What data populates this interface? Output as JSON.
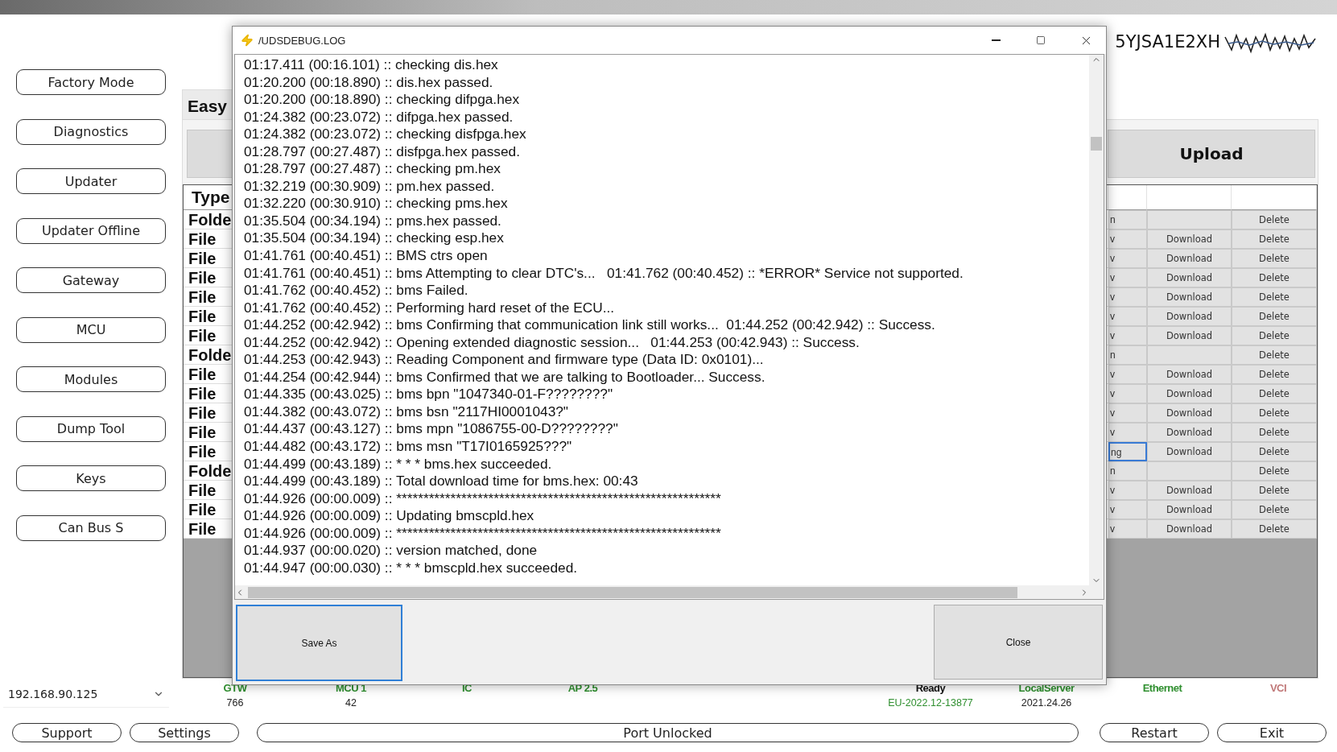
{
  "vin": "5YJSA1E2XH",
  "sidebar": {
    "buttons": [
      "Factory Mode",
      "Diagnostics",
      "Updater",
      "Updater Offline",
      "Gateway",
      "MCU",
      "Modules",
      "Dump Tool",
      "Keys",
      "Can Bus S"
    ]
  },
  "tab": {
    "label": "Easy"
  },
  "upload_button": "Upload",
  "table": {
    "columns": [
      "Type"
    ],
    "rows": [
      {
        "type": "Folde",
        "column_2": "n",
        "delete": "Delete",
        "selected": false
      },
      {
        "type": "File",
        "column_2": "v",
        "download": "Download",
        "delete": "Delete",
        "selected": false
      },
      {
        "type": "File",
        "column_2": "v",
        "download": "Download",
        "delete": "Delete",
        "selected": false
      },
      {
        "type": "File",
        "column_2": "v",
        "download": "Download",
        "delete": "Delete",
        "selected": false
      },
      {
        "type": "File",
        "column_2": "v",
        "download": "Download",
        "delete": "Delete",
        "selected": false
      },
      {
        "type": "File",
        "column_2": "v",
        "download": "Download",
        "delete": "Delete",
        "selected": false
      },
      {
        "type": "File",
        "column_2": "v",
        "download": "Download",
        "delete": "Delete",
        "selected": false
      },
      {
        "type": "Folde",
        "column_2": "n",
        "delete": "Delete",
        "selected": false
      },
      {
        "type": "File",
        "column_2": "v",
        "download": "Download",
        "delete": "Delete",
        "selected": false
      },
      {
        "type": "File",
        "column_2": "v",
        "download": "Download",
        "delete": "Delete",
        "selected": false
      },
      {
        "type": "File",
        "column_2": "v",
        "download": "Download",
        "delete": "Delete",
        "selected": false
      },
      {
        "type": "File",
        "column_2": "v",
        "download": "Download",
        "delete": "Delete",
        "selected": false
      },
      {
        "type": "File",
        "column_2": "ng",
        "download": "Download",
        "delete": "Delete",
        "selected": true
      },
      {
        "type": "Folde",
        "column_2": "n",
        "delete": "Delete",
        "selected": false
      },
      {
        "type": "File",
        "column_2": "v",
        "download": "Download",
        "delete": "Delete",
        "selected": false
      },
      {
        "type": "File",
        "column_2": "v",
        "download": "Download",
        "delete": "Delete",
        "selected": false
      },
      {
        "type": "File",
        "column_2": "v",
        "download": "Download",
        "delete": "Delete",
        "selected": false
      }
    ]
  },
  "dialog": {
    "title": "/UDSDEBUG.LOG",
    "log_lines": [
      "01:17.411 (00:16.101) :: checking dis.hex",
      "01:20.200 (00:18.890) :: dis.hex passed.",
      "01:20.200 (00:18.890) :: checking difpga.hex",
      "01:24.382 (00:23.072) :: difpga.hex passed.",
      "01:24.382 (00:23.072) :: checking disfpga.hex",
      "01:28.797 (00:27.487) :: disfpga.hex passed.",
      "01:28.797 (00:27.487) :: checking pm.hex",
      "01:32.219 (00:30.909) :: pm.hex passed.",
      "01:32.220 (00:30.910) :: checking pms.hex",
      "01:35.504 (00:34.194) :: pms.hex passed.",
      "01:35.504 (00:34.194) :: checking esp.hex",
      "01:41.761 (00:40.451) :: BMS ctrs open",
      "01:41.761 (00:40.451) :: bms Attempting to clear DTC's...   01:41.762 (00:40.452) :: *ERROR* Service not supported.",
      "01:41.762 (00:40.452) :: bms Failed.",
      "01:41.762 (00:40.452) :: Performing hard reset of the ECU...",
      "01:44.252 (00:42.942) :: bms Confirming that communication link still works...  01:44.252 (00:42.942) :: Success.",
      "01:44.252 (00:42.942) :: Opening extended diagnostic session...   01:44.253 (00:42.943) :: Success.",
      "01:44.253 (00:42.943) :: Reading Component and firmware type (Data ID: 0x0101)...",
      "01:44.254 (00:42.944) :: bms Confirmed that we are talking to Bootloader... Success.",
      "01:44.335 (00:43.025) :: bms bpn \"1047340-01-F????????\"",
      "01:44.382 (00:43.072) :: bms bsn \"2117HI0001043?\"",
      "01:44.437 (00:43.127) :: bms mpn \"1086755-00-D????????\"",
      "01:44.482 (00:43.172) :: bms msn \"T17I0165925???\"",
      "01:44.499 (00:43.189) :: * * * bms.hex succeeded.",
      "01:44.499 (00:43.189) :: Total download time for bms.hex: 00:43",
      "01:44.926 (00:00.009) :: ************************************************************",
      "01:44.926 (00:00.009) :: Updating bmscpld.hex",
      "01:44.926 (00:00.009) :: ************************************************************",
      "01:44.937 (00:00.020) :: version matched, done",
      "01:44.947 (00:00.030) :: * * * bmscpld.hex succeeded."
    ],
    "buttons": [
      {
        "label": "Save As",
        "focused": true
      },
      {
        "label": "Close",
        "focused": false
      }
    ]
  },
  "ip_field": {
    "value": "192.168.90.125"
  },
  "status_left": [
    {
      "label": "GTW",
      "color": "#2f8f2f",
      "value": "766",
      "value_highlighted": false
    },
    {
      "label": "MCU 1",
      "color": "#2f8f2f",
      "value": "42",
      "value_highlighted": false
    },
    {
      "label": "IC",
      "color": "#2f8f2f"
    },
    {
      "label": "AP 2.5",
      "color": "#2f8f2f"
    }
  ],
  "status_right": [
    {
      "label": "Ready",
      "color": "#111111",
      "value": "EU-2022.12-13877",
      "value_highlighted": true
    },
    {
      "label": "LocalServer",
      "color": "#2f8f2f",
      "value": "2021.24.26",
      "value_highlighted": false
    },
    {
      "label": "Ethernet",
      "color": "#2f8f2f"
    },
    {
      "label": "VCI",
      "color": "#c07878"
    }
  ],
  "bottom_bar": {
    "left_buttons": [
      "Support",
      "Settings"
    ],
    "status": "Port Unlocked",
    "right_buttons": [
      "Restart",
      "Exit"
    ]
  }
}
